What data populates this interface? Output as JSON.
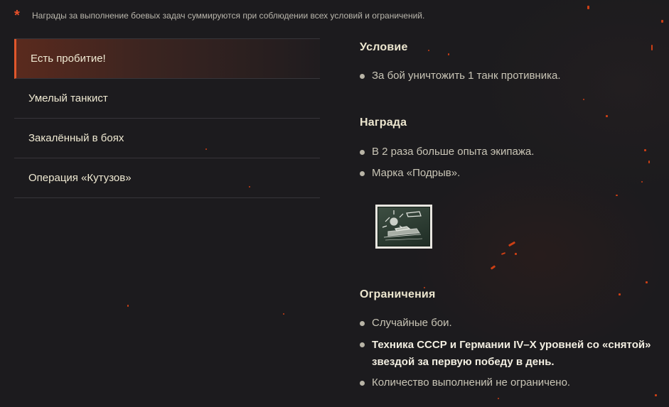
{
  "note": {
    "marker": "*",
    "text": "Награды за выполнение боевых задач суммируются при соблюдении всех условий и ограничений."
  },
  "tabs": [
    {
      "label": "Есть пробитие!",
      "active": true
    },
    {
      "label": "Умелый танкист",
      "active": false
    },
    {
      "label": "Закалённый в боях",
      "active": false
    },
    {
      "label": "Операция «Кутузов»",
      "active": false
    }
  ],
  "condition": {
    "title": "Условие",
    "items": [
      "За бой уничтожить 1 танк противника."
    ]
  },
  "reward": {
    "title": "Награда",
    "items": [
      "В 2 раза больше опыта экипажа.",
      "Марка «Подрыв»."
    ]
  },
  "restrictions": {
    "title": "Ограничения",
    "items": [
      "Случайные бои.",
      "Техника СССР и Германии IV–X уровней со «снятой» звездой за первую победу в день.",
      "Количество выполнений не ограничено."
    ]
  },
  "colors": {
    "accent": "#e0572c",
    "background": "#1c1b1e",
    "spark": "#e04414"
  }
}
